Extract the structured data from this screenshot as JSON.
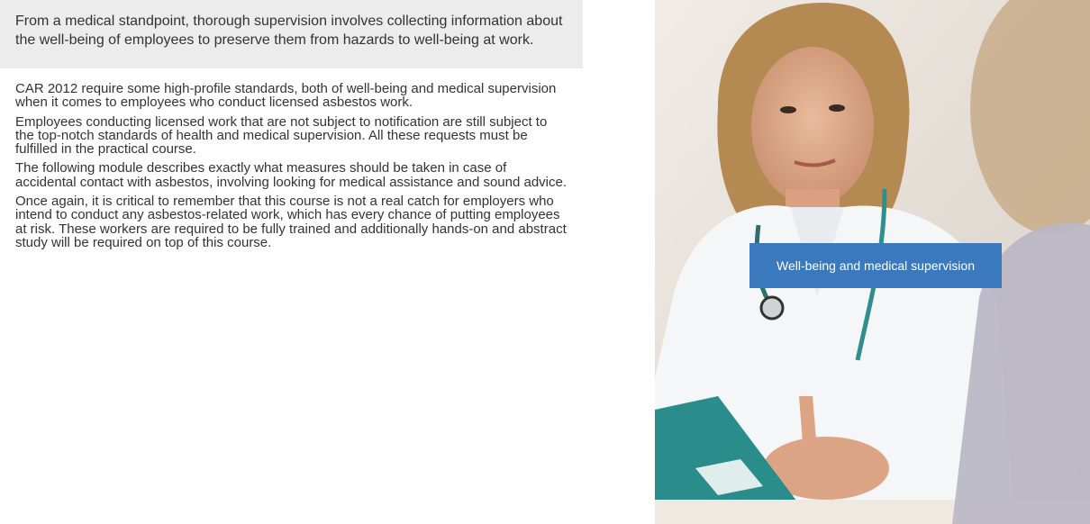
{
  "intro": {
    "text": "From a medical standpoint, thorough supervision involves collecting information about the well-being of employees to preserve them from hazards to well-being at work."
  },
  "body": {
    "paragraphs": [
      "CAR 2012 require some high-profile standards, both of well-being and medical supervision when it comes to employees who conduct licensed asbestos work.",
      "Employees conducting licensed work that are not subject to notification are still subject to the top-notch standards of health and medical supervision. All these requests must be fulfilled in the practical course.",
      "The following module describes exactly what measures should be taken in case of accidental contact with asbestos, involving looking for medical assistance and sound advice.",
      "Once again, it is critical to remember that this course is not a real catch for employers who intend to conduct any asbestos-related work, which has every chance of putting employees at risk. These workers are required to be fully trained and additionally hands-on and abstract study will be required on top of this course."
    ]
  },
  "photo": {
    "icon": "doctor-consultation-photo",
    "tag_label": "Well-being and medical supervision"
  },
  "colors": {
    "intro_bg": "#ececec",
    "accent": "#3a79bd",
    "text": "#333333"
  }
}
